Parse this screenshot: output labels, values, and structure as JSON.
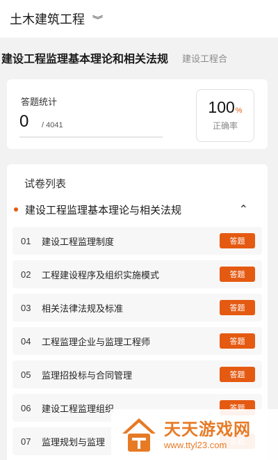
{
  "header": {
    "category": "土木建筑工程",
    "category_chevron_icon": "chevron-double-down-icon"
  },
  "subject_tabs": [
    {
      "label": "建设工程监理基本理论和相关法规",
      "active": true
    },
    {
      "label": "建设工程合",
      "active": false
    }
  ],
  "stats": {
    "answered_label": "答题统计",
    "answered_count": "0",
    "total_text": "/ 4041",
    "accuracy_value": "100",
    "accuracy_symbol": "%",
    "accuracy_label": "正确率"
  },
  "papers": {
    "title": "试卷列表",
    "group_title": "建设工程监理基本理论与相关法规",
    "collapse_icon": "chevron-up-icon",
    "items": [
      {
        "num": "01",
        "name": "建设工程监理制度",
        "action": "答题"
      },
      {
        "num": "02",
        "name": "工程建设程序及组织实施模式",
        "action": "答题"
      },
      {
        "num": "03",
        "name": "相关法律法规及标准",
        "action": "答题"
      },
      {
        "num": "04",
        "name": "工程监理企业与监理工程师",
        "action": "答题"
      },
      {
        "num": "05",
        "name": "监理招投标与合同管理",
        "action": "答题"
      },
      {
        "num": "06",
        "name": "建设工程监理组织",
        "action": "答题"
      },
      {
        "num": "07",
        "name": "监理规划与监理",
        "action": "答题"
      }
    ]
  },
  "watermark": {
    "name": "天天游戏网",
    "url": "www.ttyl23.com"
  },
  "colors": {
    "accent": "#e55a12",
    "watermark": "#e67a25",
    "background": "#f2f2f2"
  }
}
